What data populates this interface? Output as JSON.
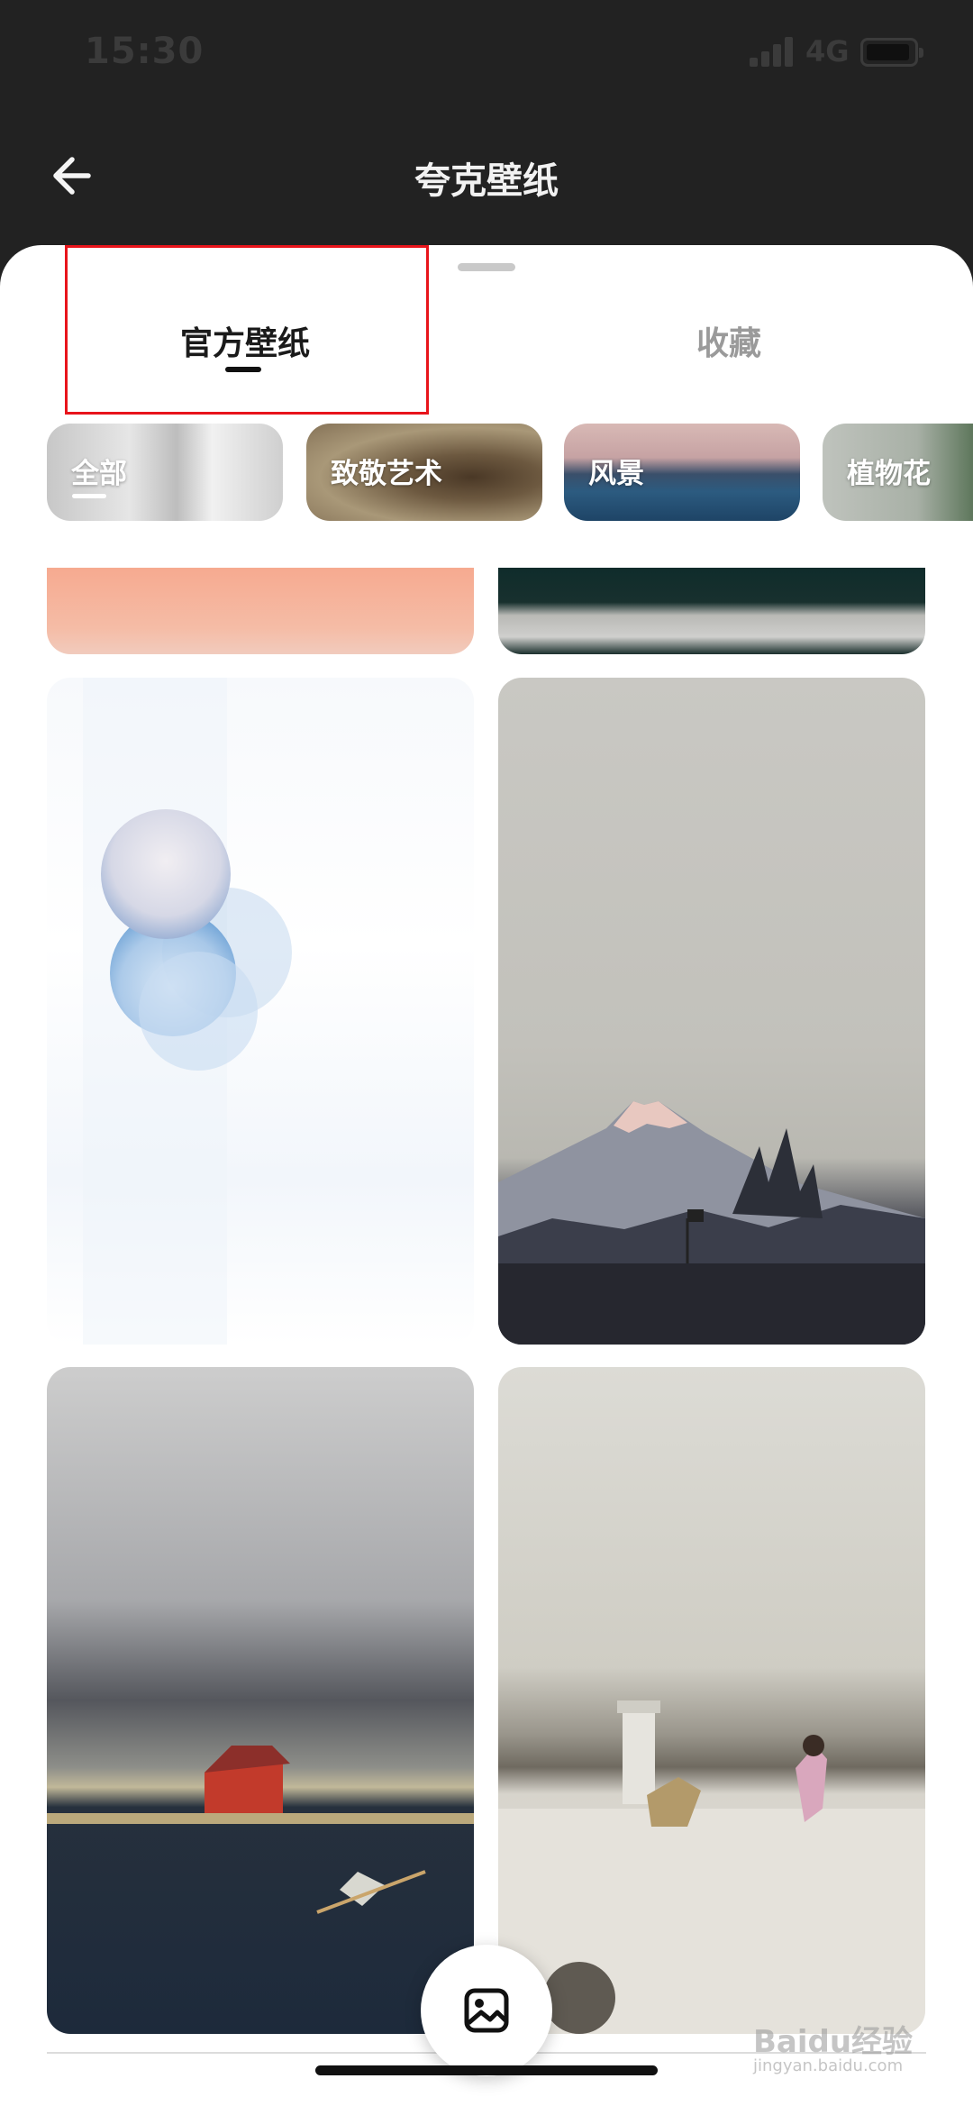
{
  "status_bar": {
    "time": "15:30",
    "network": "4G",
    "battery_level": 0.9
  },
  "nav": {
    "title": "夸克壁纸",
    "back_icon": "arrow-left-icon"
  },
  "tabs": [
    {
      "label": "官方壁纸",
      "active": true
    },
    {
      "label": "收藏",
      "active": false
    }
  ],
  "categories": [
    {
      "label": "全部",
      "selected": true
    },
    {
      "label": "致敬艺术",
      "selected": false
    },
    {
      "label": "风景",
      "selected": false
    },
    {
      "label": "植物花",
      "selected": false
    }
  ],
  "fab": {
    "icon": "image-icon"
  },
  "watermark": {
    "text": "Baidu经验",
    "sub": "jingyan.baidu.com"
  },
  "colors": {
    "header_bg": "#222222",
    "sheet_bg": "#ffffff",
    "highlight": "#e8141b",
    "active_tab": "#1a1a1a",
    "inactive_tab": "#9a9a9a"
  }
}
